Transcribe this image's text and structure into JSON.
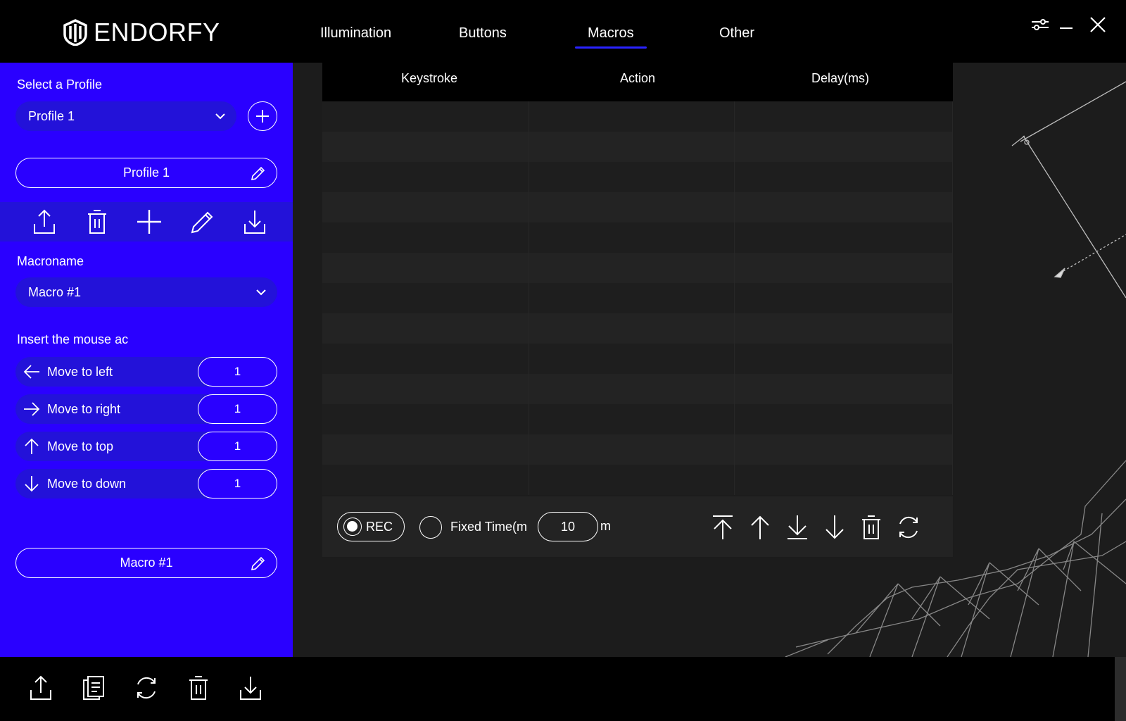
{
  "app": {
    "brand": "ENDORFY",
    "colors": {
      "accent": "#2a00ff",
      "accent_dark": "#2312d9",
      "background": "#000000",
      "panel": "#1c1c1c"
    }
  },
  "nav": {
    "tabs": [
      {
        "label": "Illumination",
        "active": false
      },
      {
        "label": "Buttons",
        "active": false
      },
      {
        "label": "Macros",
        "active": true
      },
      {
        "label": "Other",
        "active": false
      }
    ]
  },
  "window_controls": [
    "settings-sliders-icon",
    "minimize-icon",
    "close-icon"
  ],
  "sidebar": {
    "profile_label": "Select a Profile",
    "profile_selected": "Profile 1",
    "profile_name": "Profile 1",
    "profile_actions": [
      "export-icon",
      "delete-icon",
      "add-icon",
      "edit-icon",
      "import-icon"
    ],
    "macro_label": "Macroname",
    "macro_selected": "Macro #1",
    "mouse_label": "Insert the mouse ac",
    "mouse_actions": [
      {
        "label": "Move to left",
        "value": "1",
        "icon": "arrow-left-icon"
      },
      {
        "label": "Move to right",
        "value": "1",
        "icon": "arrow-right-icon"
      },
      {
        "label": "Move to top",
        "value": "1",
        "icon": "arrow-up-icon"
      },
      {
        "label": "Move to down",
        "value": "1",
        "icon": "arrow-down-icon"
      }
    ],
    "macro_name": "Macro #1"
  },
  "macro_table": {
    "columns": [
      "Keystroke",
      "Action",
      "Delay(ms)"
    ],
    "rows": []
  },
  "recorder": {
    "rec_label": "REC",
    "fixed_time_label": "Fixed Time(m",
    "fixed_time_value": "10",
    "unit": "m",
    "actions": [
      "move-to-top-icon",
      "move-up-icon",
      "move-to-bottom-icon",
      "move-down-icon",
      "delete-icon",
      "refresh-icon"
    ]
  },
  "footer": {
    "actions": [
      "export-icon",
      "copy-icon",
      "refresh-icon",
      "delete-icon",
      "import-icon"
    ]
  }
}
